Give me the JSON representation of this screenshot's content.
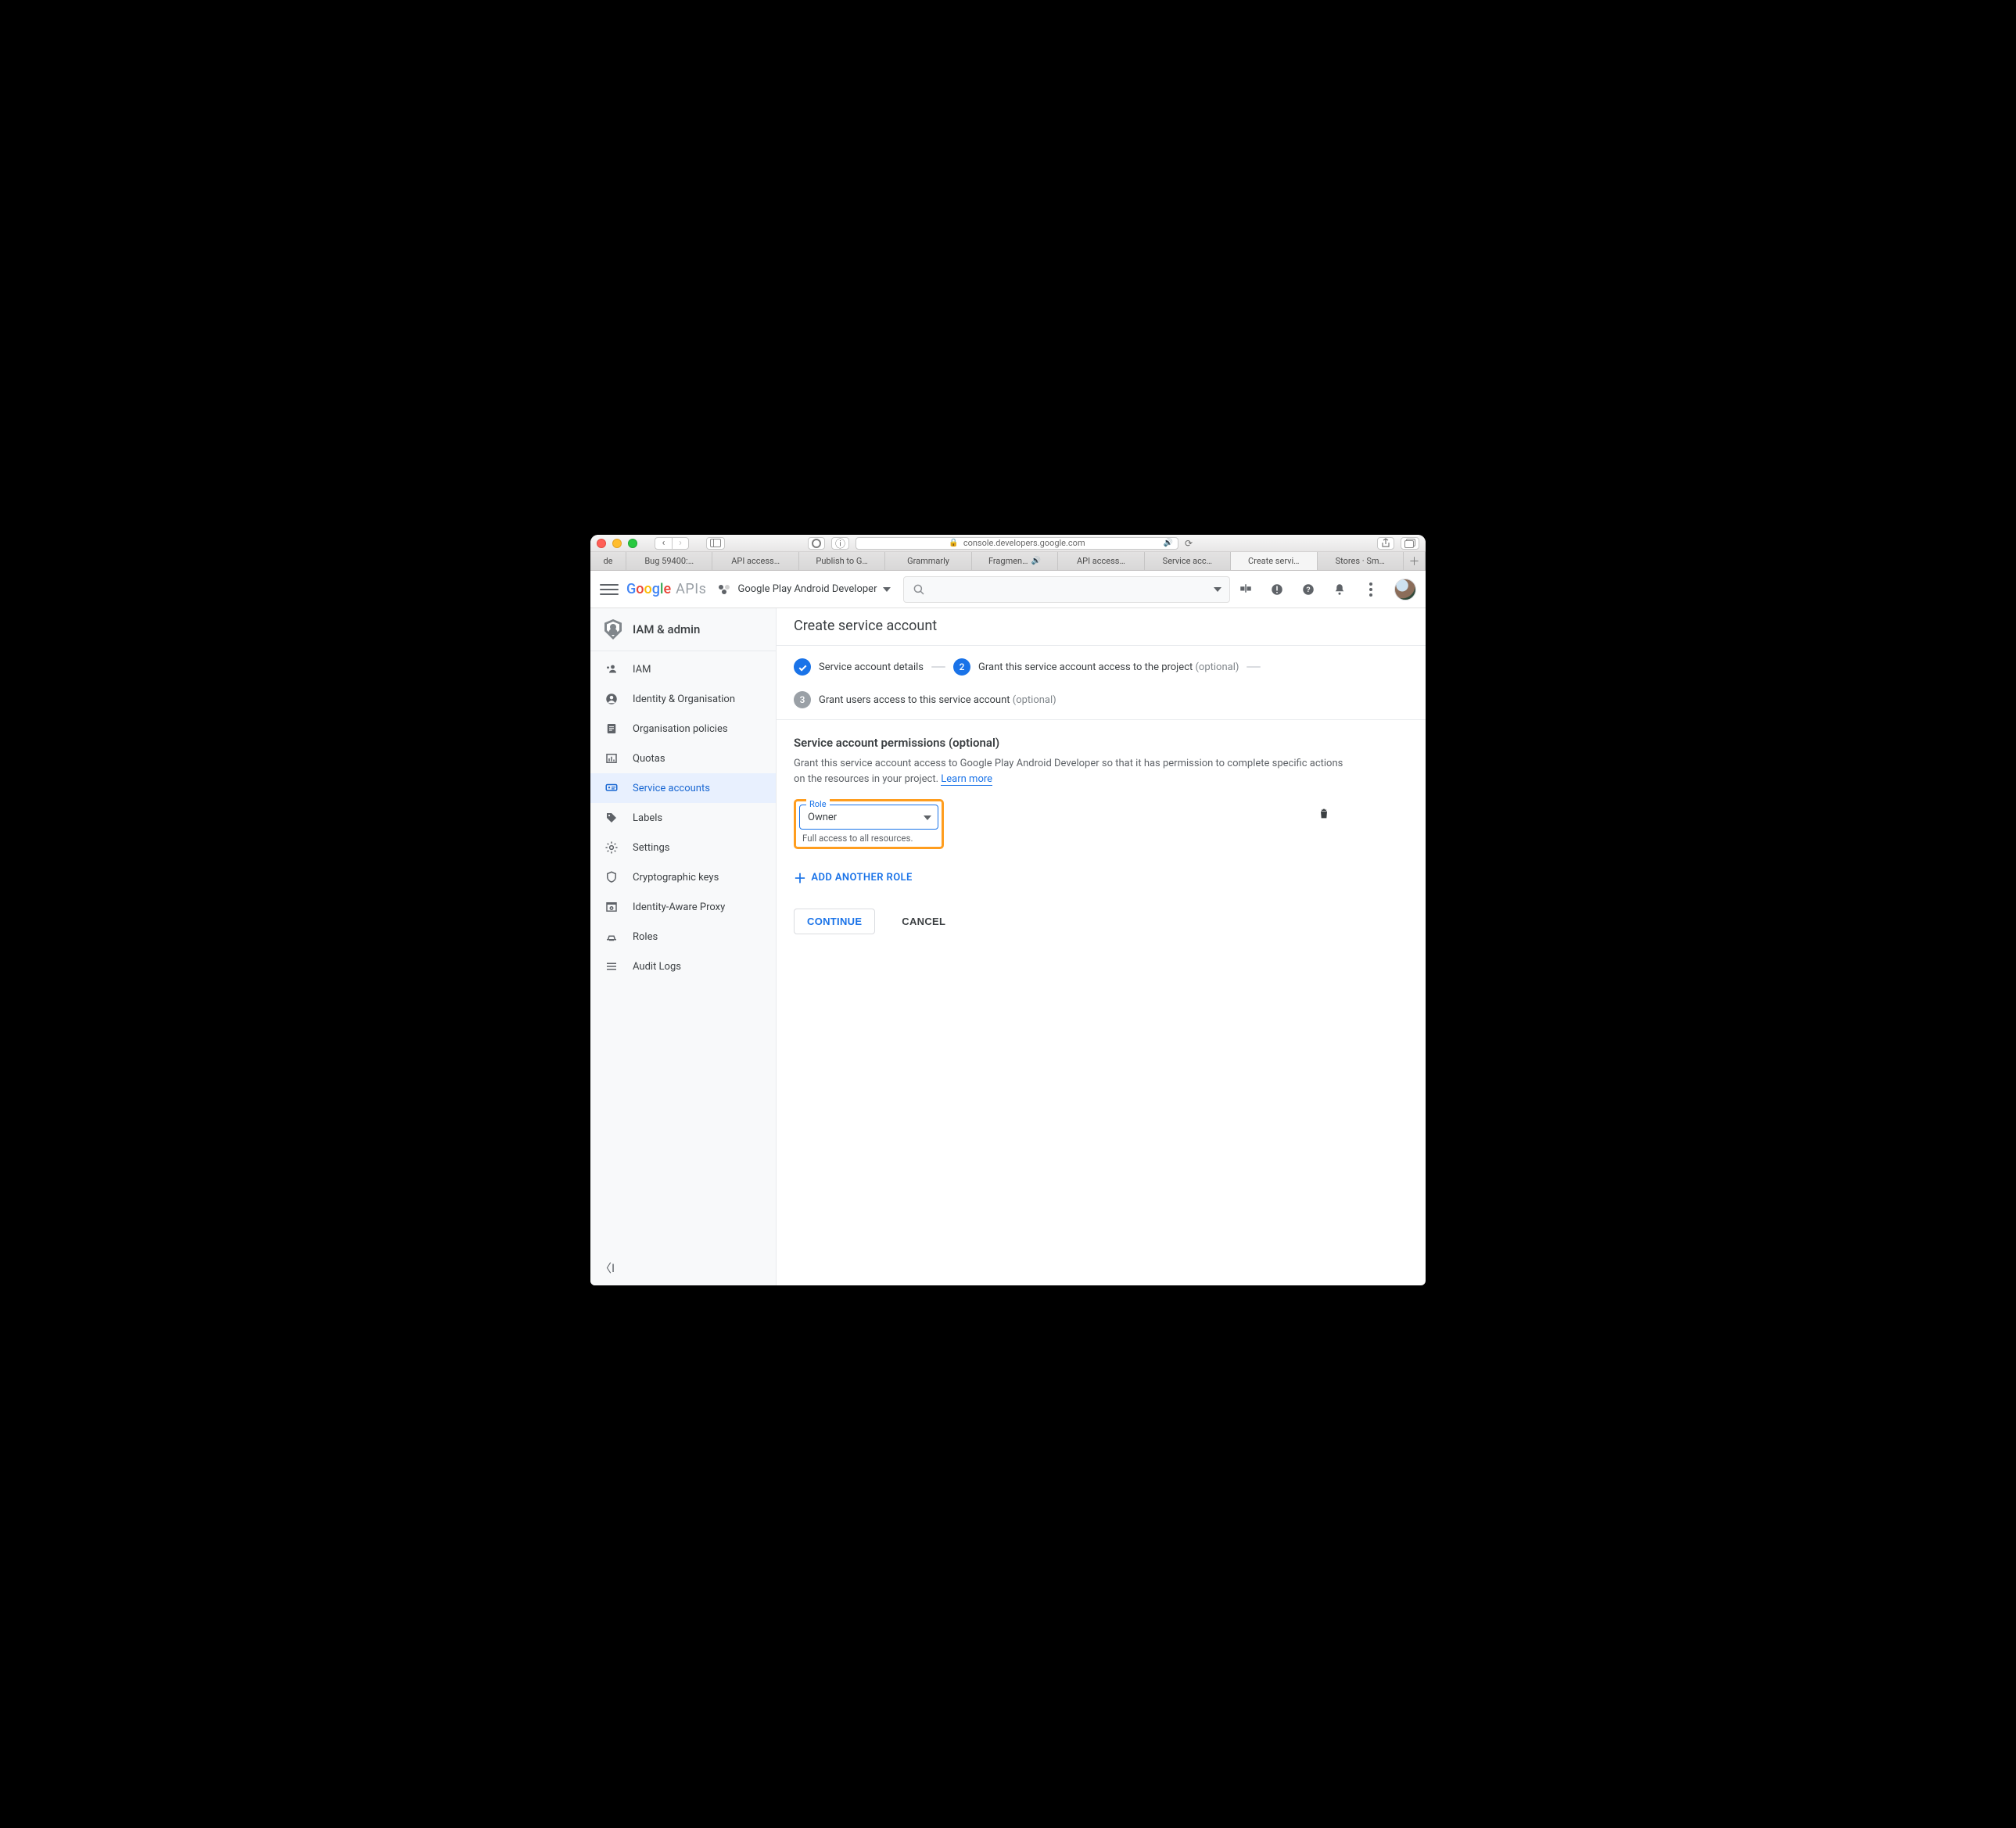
{
  "browser": {
    "address": "console.developers.google.com",
    "tabs": [
      {
        "label": "de"
      },
      {
        "label": "Bug 59400:…"
      },
      {
        "label": "API access…"
      },
      {
        "label": "Publish to G…"
      },
      {
        "label": "Grammarly"
      },
      {
        "label": "Fragmen…",
        "audio": true
      },
      {
        "label": "API access…"
      },
      {
        "label": "Service acc…"
      },
      {
        "label": "Create servi…",
        "active": true
      },
      {
        "label": "Stores · Sm…"
      }
    ]
  },
  "gc": {
    "brand_apis": "APIs",
    "project": "Google Play Android Developer"
  },
  "sidebar": {
    "group": "IAM & admin",
    "items": [
      {
        "label": "IAM"
      },
      {
        "label": "Identity & Organisation"
      },
      {
        "label": "Organisation policies"
      },
      {
        "label": "Quotas"
      },
      {
        "label": "Service accounts",
        "active": true
      },
      {
        "label": "Labels"
      },
      {
        "label": "Settings"
      },
      {
        "label": "Cryptographic keys"
      },
      {
        "label": "Identity-Aware Proxy"
      },
      {
        "label": "Roles"
      },
      {
        "label": "Audit Logs"
      }
    ]
  },
  "main": {
    "title": "Create service account",
    "steps": {
      "s1": "Service account details",
      "s2": "Grant this service account access to the project",
      "s2_opt": "(optional)",
      "s3_num": "3",
      "s3": "Grant users access to this service account",
      "s3_opt": "(optional)"
    },
    "perm": {
      "heading": "Service account permissions (optional)",
      "desc": "Grant this service account access to Google Play Android Developer so that it has permission to complete specific actions on the resources in your project. ",
      "learn": "Learn more",
      "role_label": "Role",
      "role_value": "Owner",
      "role_hint": "Full access to all resources.",
      "add": "ADD ANOTHER ROLE",
      "continue": "CONTINUE",
      "cancel": "CANCEL"
    }
  }
}
